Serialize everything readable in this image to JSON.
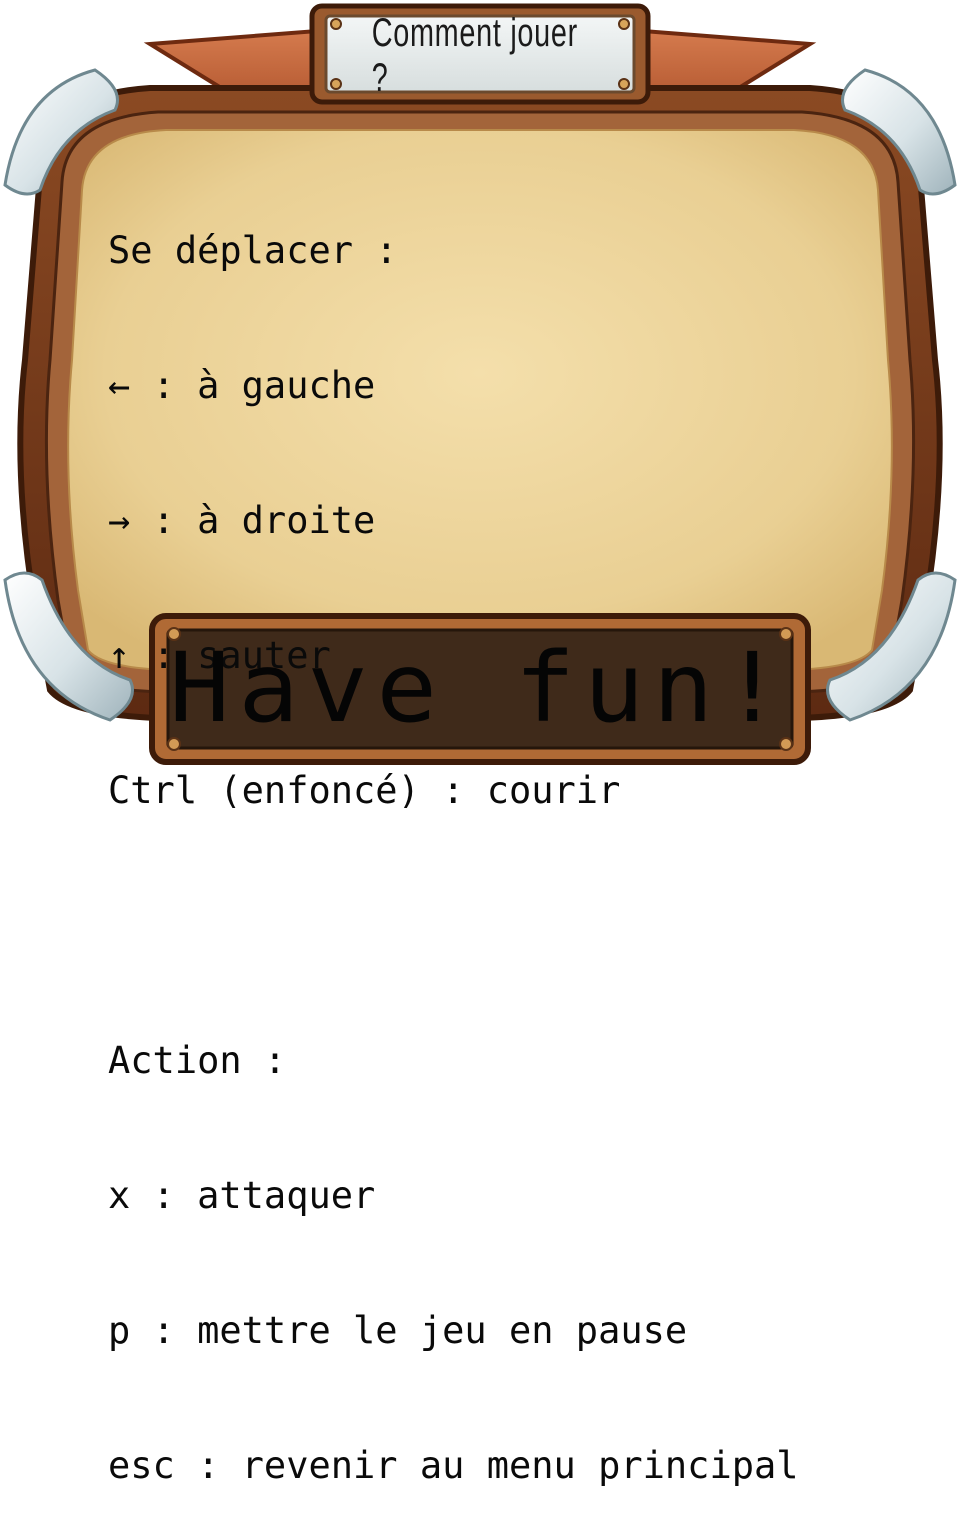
{
  "title_banner": {
    "text": "Comment jouer ?"
  },
  "instructions": {
    "move_heading": "Se déplacer :",
    "move_lines": [
      "← : à gauche",
      "→ : à droite",
      "↑ : sauter",
      "Ctrl (enfoncé) : courir"
    ],
    "action_heading": "Action :",
    "action_lines": [
      "x : attaquer",
      "p : mettre le jeu en pause",
      "esc : revenir au menu principal"
    ]
  },
  "footer_sign": {
    "text": "Have fun!"
  },
  "colors": {
    "parchment": "#ecd49a",
    "wood": "#7a3a1a",
    "ribbon": "#c8643a",
    "glass": "#d9e4e8",
    "sign": "#3f2a1a"
  }
}
